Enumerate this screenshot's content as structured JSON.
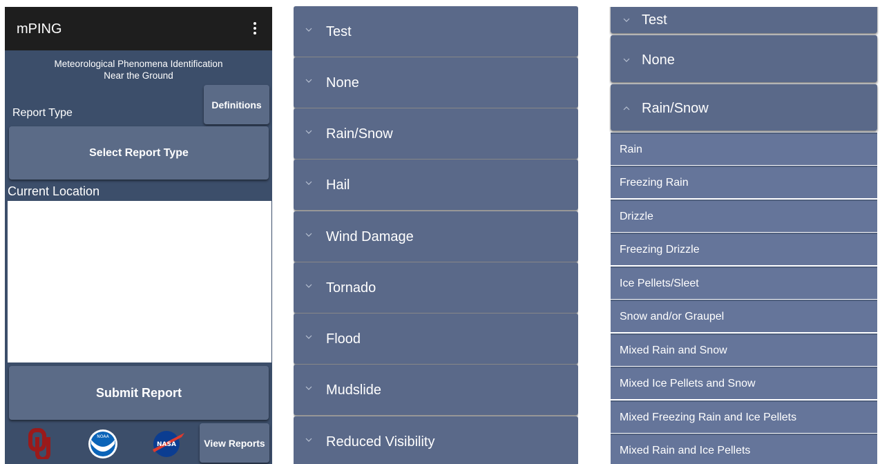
{
  "main": {
    "app_title": "mPING",
    "subtitle_line1": "Meteorological Phenomena Identification",
    "subtitle_line2": "Near the Ground",
    "definitions_button": "Definitions",
    "report_type_label": "Report Type",
    "select_report_type_button": "Select Report Type",
    "current_location_label": "Current Location",
    "submit_report_button": "Submit Report",
    "view_reports_button": "View Reports",
    "logos": {
      "ou_logo_text": "OU",
      "noaa_logo_text": "NOAA",
      "nasa_logo_text": "NASA"
    }
  },
  "collapsed_list": {
    "categories": [
      "Test",
      "None",
      "Rain/Snow",
      "Hail",
      "Wind Damage",
      "Tornado",
      "Flood",
      "Mudslide",
      "Reduced Visibility"
    ]
  },
  "expanded_list": {
    "headers": [
      "Test",
      "None",
      "Rain/Snow"
    ],
    "expanded_category": "Rain/Snow",
    "items": [
      "Rain",
      "Freezing Rain",
      "Drizzle",
      "Freezing Drizzle",
      "Ice Pellets/Sleet",
      "Snow and/or Graupel",
      "Mixed Rain and Snow",
      "Mixed Ice Pellets and Snow",
      "Mixed Freezing Rain and Ice Pellets",
      "Mixed Rain and Ice Pellets"
    ]
  },
  "colors": {
    "app_bar": "#1e1e1e",
    "background": "#3c4e6a",
    "button": "#5b6b87",
    "accordion_header": "#5a6989",
    "list_item": "#65759a",
    "ou_crimson": "#9a1a1a",
    "noaa_blue": "#0b64b8",
    "nasa_blue": "#0b3d91",
    "nasa_red": "#e03a2d"
  }
}
